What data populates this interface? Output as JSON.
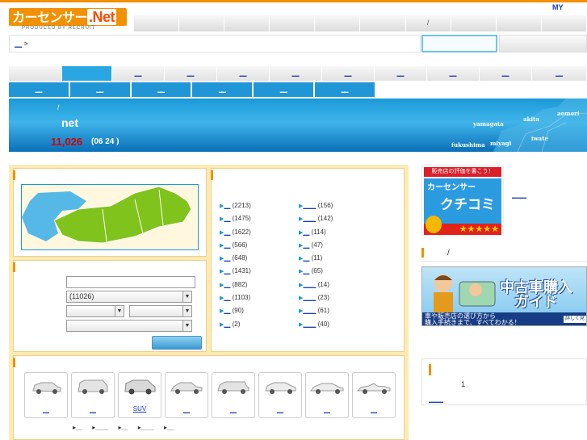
{
  "header": {
    "logo_text": "カーセンサー",
    "logo_net": ".Net",
    "logo_sub": "PRODUCED BY RECRUIT",
    "my_label": "MY",
    "gnav": [
      "",
      "",
      "",
      "",
      "",
      "",
      "/",
      "",
      "",
      ""
    ]
  },
  "breadcrumb": {
    "link": "＿",
    "sep": ">"
  },
  "tabs_top": [
    "",
    "",
    "＿",
    "＿",
    "＿",
    "＿",
    "＿",
    "＿",
    "＿",
    "＿",
    "＿"
  ],
  "tabs_sub": [
    "＿",
    "＿",
    "＿",
    "＿",
    "＿",
    "＿"
  ],
  "banner": {
    "slash": "/",
    "title": "net",
    "count": "11,026",
    "date": "(06 24    )",
    "prefectures": [
      "aomori",
      "akita",
      "yamagata",
      "iwate",
      "miyagi",
      "fukushima"
    ]
  },
  "search": {
    "count_field": "(11026)"
  },
  "cities": {
    "left": [
      {
        "link": "＿",
        "count": "(2213)"
      },
      {
        "link": "＿",
        "count": "(1475)"
      },
      {
        "link": "＿",
        "count": "(1622)"
      },
      {
        "link": "＿",
        "count": "(566)"
      },
      {
        "link": "＿",
        "count": "(648)"
      },
      {
        "link": "＿",
        "count": "(1431)"
      },
      {
        "link": "＿",
        "count": "(882)"
      },
      {
        "link": "＿",
        "count": "(1103)"
      },
      {
        "link": "＿",
        "count": "(90)"
      },
      {
        "link": "＿",
        "count": "(2)"
      }
    ],
    "right": [
      {
        "link": "＿＿",
        "count": "(156)"
      },
      {
        "link": "＿＿",
        "count": "(142)"
      },
      {
        "link": "＿",
        "count": "(114)"
      },
      {
        "link": "＿",
        "count": "(47)"
      },
      {
        "link": "＿",
        "count": "(11)"
      },
      {
        "link": "＿",
        "count": "(65)"
      },
      {
        "link": "＿＿",
        "count": "(14)"
      },
      {
        "link": "＿＿",
        "count": "(23)"
      },
      {
        "link": "＿＿",
        "count": "(61)"
      },
      {
        "link": "＿＿",
        "count": "(40)"
      }
    ]
  },
  "cars": [
    "＿",
    "＿",
    "SUV",
    "＿",
    "＿",
    "＿",
    "＿",
    "＿"
  ],
  "car_links": [
    "▸＿",
    "▸＿＿",
    "▸＿",
    "▸＿＿",
    "▸＿"
  ],
  "side": {
    "ad1_head": "販売店の評価を書こう！",
    "ad1_brand": "カーセンサー",
    "ad1_title": "クチコミ",
    "ad1_stars": "★★★★★",
    "ad1_link": "＿＿",
    "sep_label": "/",
    "ad2_title_line1": "中古車購入",
    "ad2_title_line2": "ガイド",
    "ad2_foot1": "車や販売店の選び方から",
    "ad2_foot2": "購入手続きまで、すべてわかる！",
    "ad2_more": "詳しく見る",
    "box3_num": "1",
    "box3_link": "＿＿"
  },
  "colors": {
    "accent": "#f29100",
    "blue": "#2196d6",
    "panel": "#fdebb6",
    "count_red": "#d40000"
  }
}
